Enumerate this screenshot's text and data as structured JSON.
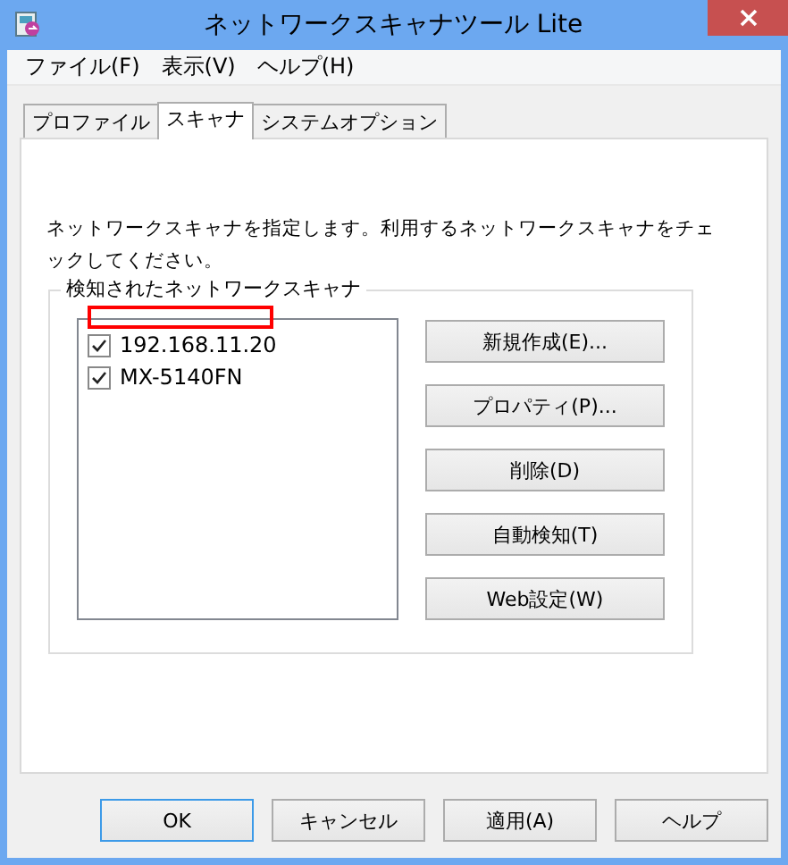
{
  "window": {
    "title": "ネットワークスキャナツール Lite"
  },
  "menu": [
    "ファイル(F)",
    "表示(V)",
    "ヘルプ(H)"
  ],
  "tabs": [
    {
      "label": "プロファイル",
      "selected": false
    },
    {
      "label": "スキャナ",
      "selected": true
    },
    {
      "label": "システムオプション",
      "selected": false
    }
  ],
  "description": "ネットワークスキャナを指定します。利用するネットワークスキャナをチェックしてください。",
  "scanner_group": {
    "title": "検知されたネットワークスキャナ",
    "annotation_box": true,
    "scanners": [
      {
        "name": "192.168.11.20",
        "checked": true
      },
      {
        "name": "MX-5140FN",
        "checked": true
      }
    ],
    "buttons": [
      "新規作成(E)...",
      "プロパティ(P)...",
      "削除(D)",
      "自動検知(T)",
      "Web設定(W)"
    ]
  },
  "dialog_buttons": [
    {
      "label": "OK",
      "default": true
    },
    {
      "label": "キャンセル",
      "default": false
    },
    {
      "label": "適用(A)",
      "default": false
    },
    {
      "label": "ヘルプ",
      "default": false
    }
  ]
}
